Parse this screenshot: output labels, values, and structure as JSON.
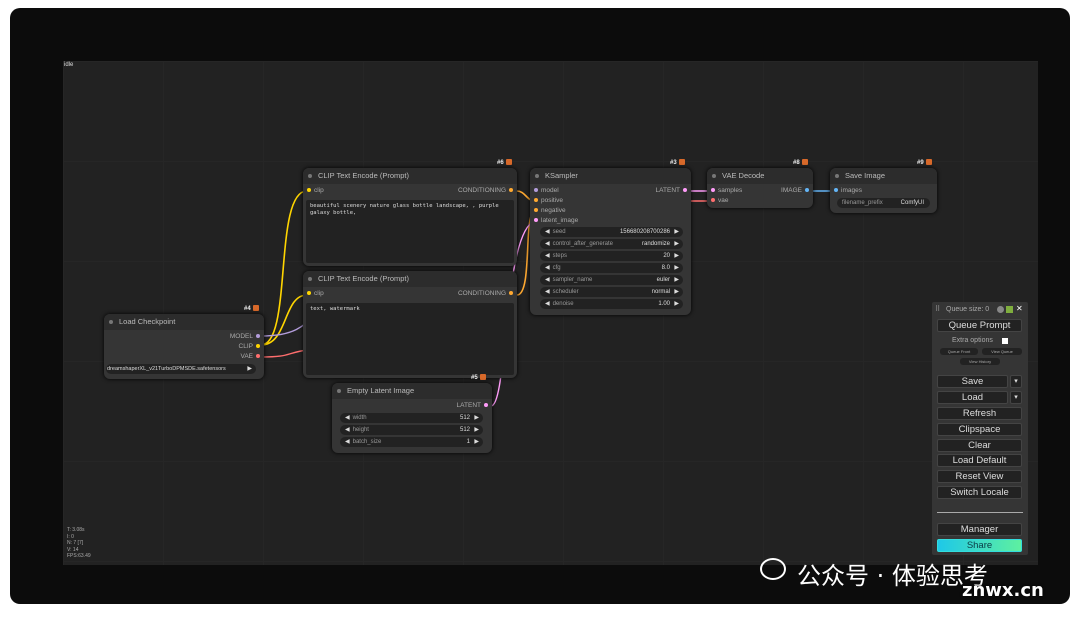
{
  "status": "idle",
  "stats": [
    "T: 3.08s",
    "I: 0",
    "N: 7 [7]",
    "V: 14",
    "FPS:63.49"
  ],
  "nodes": {
    "clip_pos": {
      "id": "#6",
      "title": "CLIP Text Encode (Prompt)",
      "input": "clip",
      "output": "CONDITIONING",
      "text": "beautiful scenery nature glass bottle landscape, , purple galaxy bottle,"
    },
    "clip_neg": {
      "title": "CLIP Text Encode (Prompt)",
      "input": "clip",
      "output": "CONDITIONING",
      "text": "text, watermark"
    },
    "ksampler": {
      "id": "#3",
      "title": "KSampler",
      "inputs": [
        "model",
        "positive",
        "negative",
        "latent_image"
      ],
      "output": "LATENT",
      "widgets": [
        {
          "label": "seed",
          "value": "156680208700286"
        },
        {
          "label": "control_after_generate",
          "value": "randomize"
        },
        {
          "label": "steps",
          "value": "20"
        },
        {
          "label": "cfg",
          "value": "8.0"
        },
        {
          "label": "sampler_name",
          "value": "euler"
        },
        {
          "label": "scheduler",
          "value": "normal"
        },
        {
          "label": "denoise",
          "value": "1.00"
        }
      ]
    },
    "vae_decode": {
      "id": "#8",
      "title": "VAE Decode",
      "inputs": [
        "samples",
        "vae"
      ],
      "output": "IMAGE"
    },
    "save_image": {
      "id": "#9",
      "title": "Save Image",
      "input": "images",
      "widget_label": "filename_prefix",
      "widget_value": "ComfyUI"
    },
    "load_checkpoint": {
      "id": "#4",
      "title": "Load Checkpoint",
      "outputs": [
        "MODEL",
        "CLIP",
        "VAE"
      ],
      "ckpt_name": "dreamshaperXL_v21TurboDPMSDE.safetensors"
    },
    "empty_latent": {
      "id": "#5",
      "title": "Empty Latent Image",
      "output": "LATENT",
      "widgets": [
        {
          "label": "width",
          "value": "512"
        },
        {
          "label": "height",
          "value": "512"
        },
        {
          "label": "batch_size",
          "value": "1"
        }
      ]
    }
  },
  "panel": {
    "queue_size": "Queue size: 0",
    "queue_prompt": "Queue Prompt",
    "extra_options": "Extra options",
    "queue_front": "Queue Front",
    "view_queue": "View Queue",
    "view_history": "View History",
    "buttons": [
      "Save",
      "Load",
      "Refresh",
      "Clipspace",
      "Clear",
      "Load Default",
      "Reset View",
      "Switch Locale"
    ],
    "manager": "Manager",
    "share": "Share",
    "close": "✕"
  },
  "watermark": {
    "text": "公众号 · 体验思考",
    "site": "znwx.cn"
  },
  "colors": {
    "clip": "#ffd500",
    "model": "#b39ddb",
    "conditioning": "#ffa931",
    "latent": "#ff9cf9",
    "vae": "#ff6e6e",
    "image": "#64b5f6"
  }
}
